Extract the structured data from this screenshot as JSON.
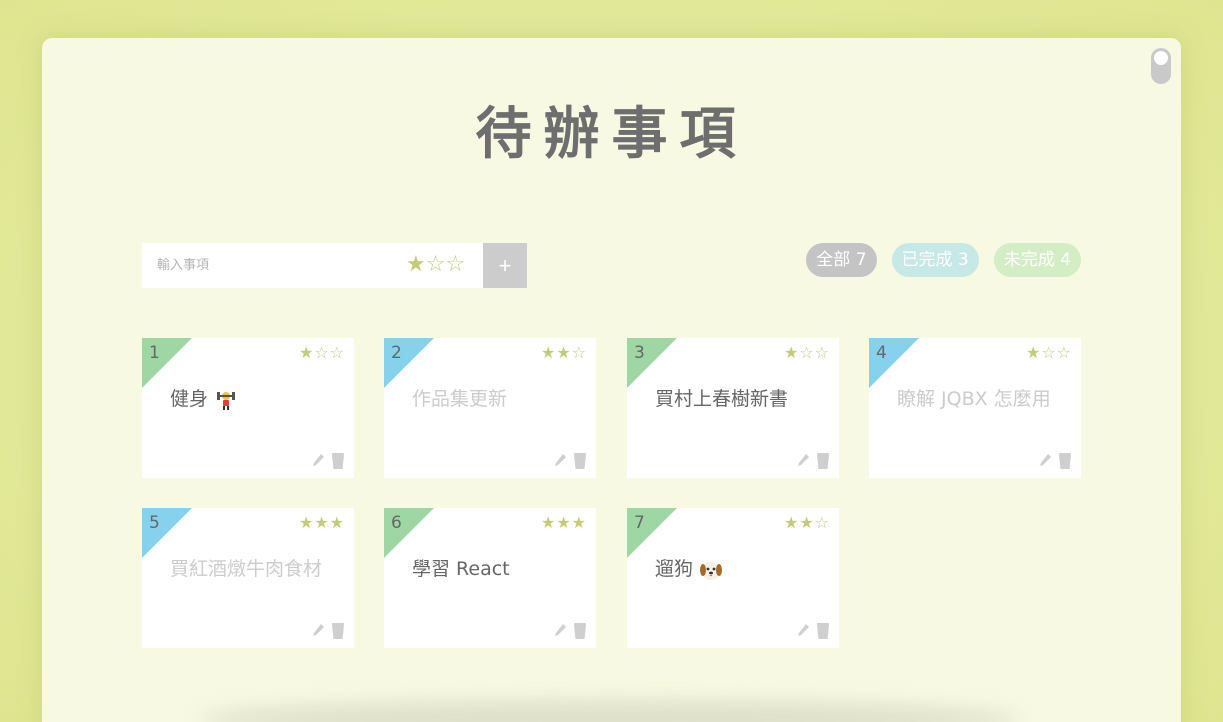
{
  "app": {
    "title": "待辦事項"
  },
  "input": {
    "placeholder": "輸入事項",
    "stars": [
      "★",
      "☆",
      "☆"
    ],
    "add_label": "+"
  },
  "filters": {
    "all": "全部 7",
    "done": "已完成 3",
    "todo": "未完成 4"
  },
  "colors": {
    "accent_star": "#c4cc7a",
    "corner_done": "#86d2ec",
    "corner_todo": "#9fd7a4",
    "background": "#f7f9e2"
  },
  "todos": [
    {
      "num": "1",
      "text": "健身",
      "stars": "★☆☆",
      "done": false,
      "emoji": "weightlifter-icon"
    },
    {
      "num": "2",
      "text": "作品集更新",
      "stars": "★★☆",
      "done": true
    },
    {
      "num": "3",
      "text": "買村上春樹新書",
      "stars": "★☆☆",
      "done": false
    },
    {
      "num": "4",
      "text": "瞭解 JQBX 怎麼用",
      "stars": "★☆☆",
      "done": true
    },
    {
      "num": "5",
      "text": "買紅酒燉牛肉食材",
      "stars": "★★★",
      "done": true
    },
    {
      "num": "6",
      "text": "學習 React",
      "stars": "★★★",
      "done": false
    },
    {
      "num": "7",
      "text": "遛狗",
      "stars": "★★☆",
      "done": false,
      "emoji": "dog-face-icon"
    }
  ]
}
